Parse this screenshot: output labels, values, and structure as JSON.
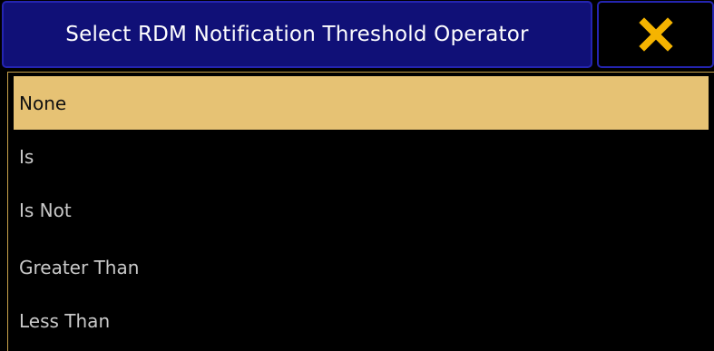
{
  "dialog": {
    "title": "Select RDM Notification Threshold Operator",
    "close_icon": "close-icon",
    "accent_color": "#e6c274",
    "title_bg_color": "#101077",
    "close_icon_color": "#f5b400"
  },
  "options": [
    {
      "label": "None",
      "selected": true
    },
    {
      "label": "Is",
      "selected": false
    },
    {
      "label": "Is Not",
      "selected": false
    },
    {
      "label": "Greater Than",
      "selected": false
    },
    {
      "label": "Less Than",
      "selected": false
    }
  ]
}
